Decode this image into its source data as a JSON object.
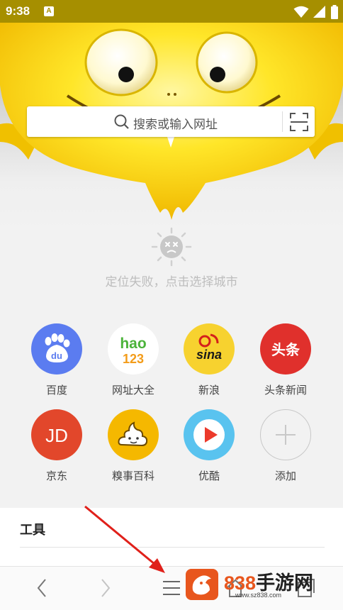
{
  "status_bar": {
    "time": "9:38",
    "notification_letter": "A"
  },
  "search": {
    "placeholder": "搜索或输入网址"
  },
  "weather": {
    "message": "定位失败，点击选择城市"
  },
  "shortcuts": [
    {
      "label": "百度",
      "icon": "baidu-icon",
      "color": "#5b7cf0"
    },
    {
      "label": "网址大全",
      "icon": "hao123-icon",
      "color": "#ffffff",
      "logo_text_top": "hao",
      "logo_text_bottom": "123"
    },
    {
      "label": "新浪",
      "icon": "sina-icon",
      "color": "#f7d22f",
      "logo_text": "sina"
    },
    {
      "label": "头条新闻",
      "icon": "toutiao-icon",
      "color": "#e0302c",
      "logo_text": "头条"
    },
    {
      "label": "京东",
      "icon": "jd-icon",
      "color": "#e2472b",
      "logo_text": "JD"
    },
    {
      "label": "糗事百科",
      "icon": "qiushi-icon",
      "color": "#f5b800"
    },
    {
      "label": "优酷",
      "icon": "youku-icon",
      "color": "#59c3ef"
    },
    {
      "label": "添加",
      "icon": "add-icon",
      "color": "#f2f2f2"
    }
  ],
  "tools": {
    "title": "工具"
  },
  "bottom_nav": {
    "items": [
      "back-icon",
      "forward-icon",
      "menu-icon",
      "home-icon",
      "tabs-icon"
    ]
  },
  "watermark": {
    "number": "838",
    "cn": "手游网",
    "url": "www.sz838.com"
  }
}
